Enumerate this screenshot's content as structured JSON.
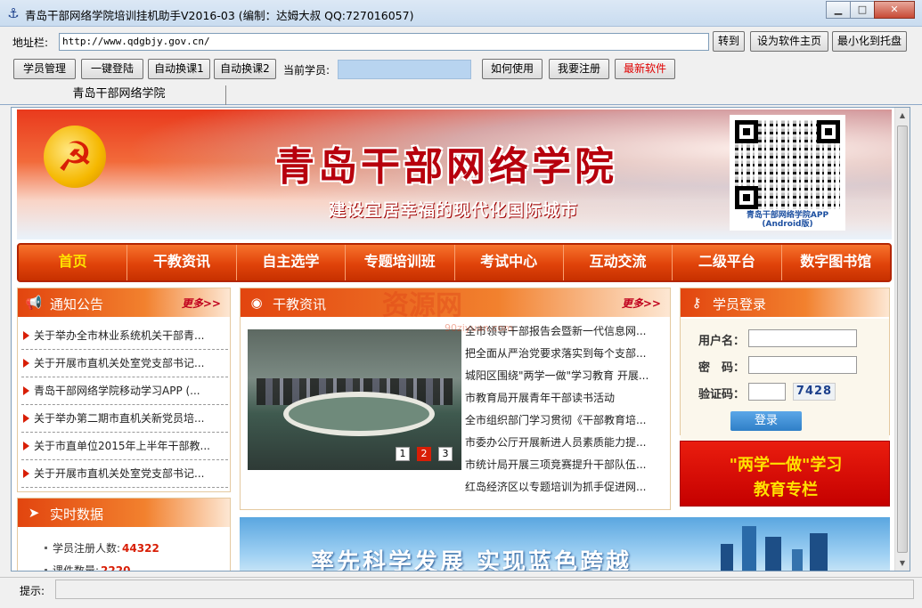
{
  "window": {
    "title": "青岛干部网络学院培训挂机助手V2016-03 (编制：达姆大叔 QQ:727016057)",
    "controls": {
      "minimize": "▁",
      "maximize": "□",
      "close": "✕"
    }
  },
  "address_bar": {
    "label": "地址栏:",
    "value": "http://www.qdgbjy.gov.cn/",
    "go_label": "转到",
    "set_home_label": "设为软件主页",
    "minimize_tray_label": "最小化到托盘"
  },
  "toolbar": {
    "student_mgmt": "学员管理",
    "one_click_login": "一键登陆",
    "auto_course_1": "自动换课1",
    "auto_course_2": "自动换课2",
    "current_student_label": "当前学员:",
    "current_student_value": "",
    "how_to_use": "如何使用",
    "register": "我要注册",
    "latest_software": "最新软件"
  },
  "tabs": [
    {
      "label": "青岛干部网络学院"
    }
  ],
  "site": {
    "title": "青岛干部网络学院",
    "slogan": "建设宜居幸福的现代化国际城市",
    "qr_caption_1": "青岛干部网络学院APP",
    "qr_caption_2": "(Android版)",
    "nav": [
      "首页",
      "干教资讯",
      "自主选学",
      "专题培训班",
      "考试中心",
      "互动交流",
      "二级平台",
      "数字图书馆"
    ],
    "notice": {
      "title": "通知公告",
      "more": "更多>>",
      "items": [
        "关于举办全市林业系统机关干部青...",
        "关于开展市直机关处室党支部书记...",
        "青岛干部网络学院移动学习APP (...",
        "关于举办第二期市直机关新党员培...",
        "关于市直单位2015年上半年干部教...",
        "关于开展市直机关处室党支部书记..."
      ]
    },
    "news": {
      "title": "干教资讯",
      "more": "更多>>",
      "pager": [
        "1",
        "2",
        "3"
      ],
      "items": [
        "全市领导干部报告会暨新一代信息网...",
        "把全面从严治党要求落实到每个支部...",
        "城阳区围绕\"两学一做\"学习教育 开展...",
        "市教育局开展青年干部读书活动",
        "全市组织部门学习贯彻《干部教育培...",
        "市委办公厅开展新进人员素质能力提...",
        "市统计局开展三项竞赛提升干部队伍...",
        "红岛经济区以专题培训为抓手促进网..."
      ]
    },
    "login": {
      "title": "学员登录",
      "username_label": "用户名：",
      "password_label": "密　码：",
      "captcha_label": "验证码：",
      "captcha_value": "7428",
      "button": "登录"
    },
    "promo": {
      "line1": "\"两学一做\"学习",
      "line2": "教育专栏"
    },
    "stats": {
      "title": "实时数据",
      "items": [
        {
          "label": "学员注册人数:",
          "value": "44322"
        },
        {
          "label": "课件数量:",
          "value": "2220"
        }
      ]
    },
    "bottom_banner": "率先科学发展 实现蓝色跨越",
    "watermark": "资源网",
    "watermark_sub": "90ziyuan.com"
  },
  "status": {
    "label": "提示:",
    "value": ""
  },
  "colors": {
    "accent": "#e2450f",
    "nav_active": "#ffe400",
    "link_red": "#d81e06"
  }
}
